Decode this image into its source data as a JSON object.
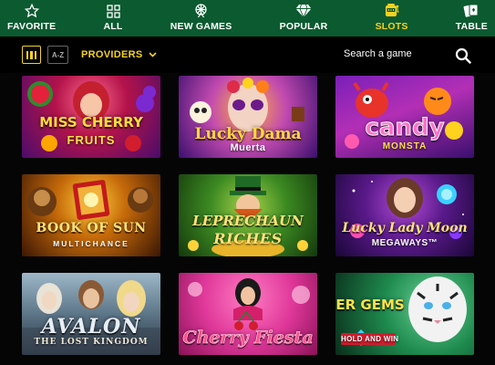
{
  "nav": {
    "items": [
      {
        "label": "FAVORITE",
        "icon": "star-icon"
      },
      {
        "label": "ALL",
        "icon": "grid-icon"
      },
      {
        "label": "NEW GAMES",
        "icon": "ferris-wheel-icon"
      },
      {
        "label": "POPULAR",
        "icon": "diamond-icon"
      },
      {
        "label": "SLOTS",
        "icon": "slot-machine-icon",
        "active": true
      },
      {
        "label": "TABLE",
        "icon": "playing-cards-icon"
      }
    ]
  },
  "filters": {
    "grid_view": "bar-grid-icon",
    "az_label": "A-Z",
    "providers_label": "PROVIDERS",
    "search_placeholder": "Search a game"
  },
  "colors": {
    "nav_bg": "#0c5a2f",
    "accent": "#f4d21f",
    "page_bg": "#050505"
  },
  "games": [
    {
      "title": "MISS CHERRY",
      "subtitle": "FRUITS"
    },
    {
      "title": "Lucky Dama",
      "subtitle": "Muerta"
    },
    {
      "title": "candy",
      "subtitle": "MONSTA"
    },
    {
      "title": "BOOK OF SUN",
      "subtitle": "MULTICHANCE"
    },
    {
      "title": "LEPRECHAUN",
      "subtitle": "RICHES"
    },
    {
      "title": "Lucky Lady Moon",
      "subtitle": "MEGAWAYS™"
    },
    {
      "title": "AVALON",
      "subtitle": "THE LOST KINGDOM"
    },
    {
      "title": "Cherry Fiesta",
      "subtitle": ""
    },
    {
      "title": "TIGER GEMS",
      "subtitle": "HOLD AND WIN"
    }
  ]
}
